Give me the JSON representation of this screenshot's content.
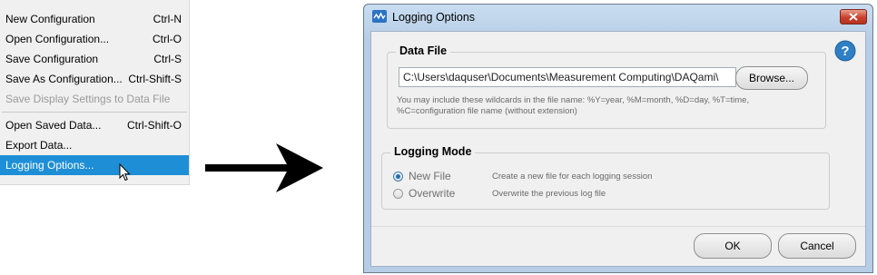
{
  "menu": {
    "items": [
      {
        "label": "New Configuration",
        "shortcut": "Ctrl-N"
      },
      {
        "label": "Open Configuration...",
        "shortcut": "Ctrl-O"
      },
      {
        "label": "Save Configuration",
        "shortcut": "Ctrl-S"
      },
      {
        "label": "Save As Configuration...",
        "shortcut": "Ctrl-Shift-S"
      },
      {
        "label": "Save Display Settings to Data File",
        "shortcut": ""
      },
      {
        "label": "Open Saved Data...",
        "shortcut": "Ctrl-Shift-O"
      },
      {
        "label": "Export Data...",
        "shortcut": ""
      },
      {
        "label": "Logging Options...",
        "shortcut": ""
      }
    ],
    "disabled_item": "Save Display Settings to Data File",
    "selected_item": "Logging Options..."
  },
  "dialog": {
    "title": "Logging Options",
    "data_file": {
      "group_title": "Data File",
      "path_value": "C:\\Users\\daquser\\Documents\\Measurement Computing\\DAQami\\",
      "browse_label": "Browse...",
      "hint": "You may include these wildcards in the file name: %Y=year, %M=month, %D=day, %T=time, %C=configuration file name (without extension)"
    },
    "logging_mode": {
      "group_title": "Logging Mode",
      "options": [
        {
          "label": "New File",
          "description": "Create a new file for each logging session",
          "selected": true
        },
        {
          "label": "Overwrite",
          "description": "Overwrite the previous log file",
          "selected": false
        }
      ]
    },
    "ok_label": "OK",
    "cancel_label": "Cancel"
  },
  "colors": {
    "selection": "#1e8fd6",
    "close_button": "#c9412c",
    "help_icon": "#2e7fc4"
  },
  "icons": [
    "cursor-arrow-icon",
    "right-arrow-icon",
    "app-logo-icon",
    "close-icon",
    "help-icon"
  ]
}
